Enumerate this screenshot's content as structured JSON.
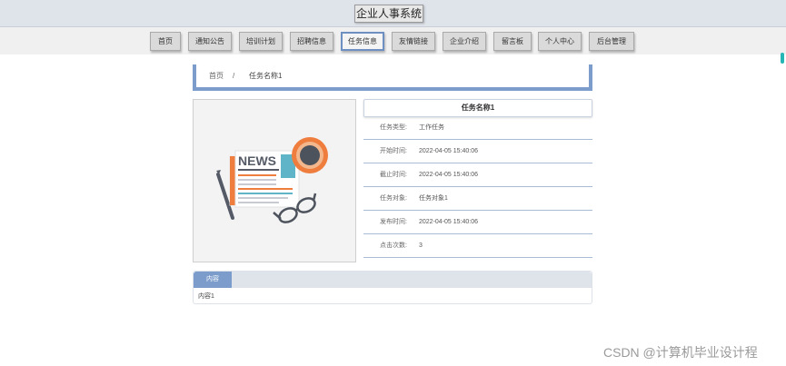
{
  "header": {
    "site_title": "企业人事系统"
  },
  "nav": {
    "items": [
      {
        "label": "首页"
      },
      {
        "label": "通知公告"
      },
      {
        "label": "培训计划"
      },
      {
        "label": "招聘信息"
      },
      {
        "label": "任务信息"
      },
      {
        "label": "友情链接"
      },
      {
        "label": "企业介绍"
      },
      {
        "label": "留言板"
      },
      {
        "label": "个人中心"
      },
      {
        "label": "后台管理"
      }
    ],
    "active_index": 4
  },
  "breadcrumb": {
    "home": "首页",
    "separator": "/",
    "current": "任务名称1"
  },
  "image": {
    "news_text": "NEWS",
    "icon": "newspaper-coffee-glasses-illustration"
  },
  "detail": {
    "title": "任务名称1",
    "rows": [
      {
        "label": "任务类型:",
        "value": "工作任务"
      },
      {
        "label": "开始时间:",
        "value": "2022-04-05 15:40:06"
      },
      {
        "label": "截止时间:",
        "value": "2022-04-05 15:40:06"
      },
      {
        "label": "任务对象:",
        "value": "任务对象1"
      },
      {
        "label": "发布时间:",
        "value": "2022-04-05 15:40:06"
      },
      {
        "label": "点击次数:",
        "value": "3"
      }
    ]
  },
  "content": {
    "tab_label": "内容",
    "text": "内容1"
  },
  "watermark": "CSDN @计算机毕业设计程",
  "colors": {
    "accent": "#7c9dcb",
    "header_bg": "#dfe3ea",
    "scroll": "#27b5b5"
  }
}
